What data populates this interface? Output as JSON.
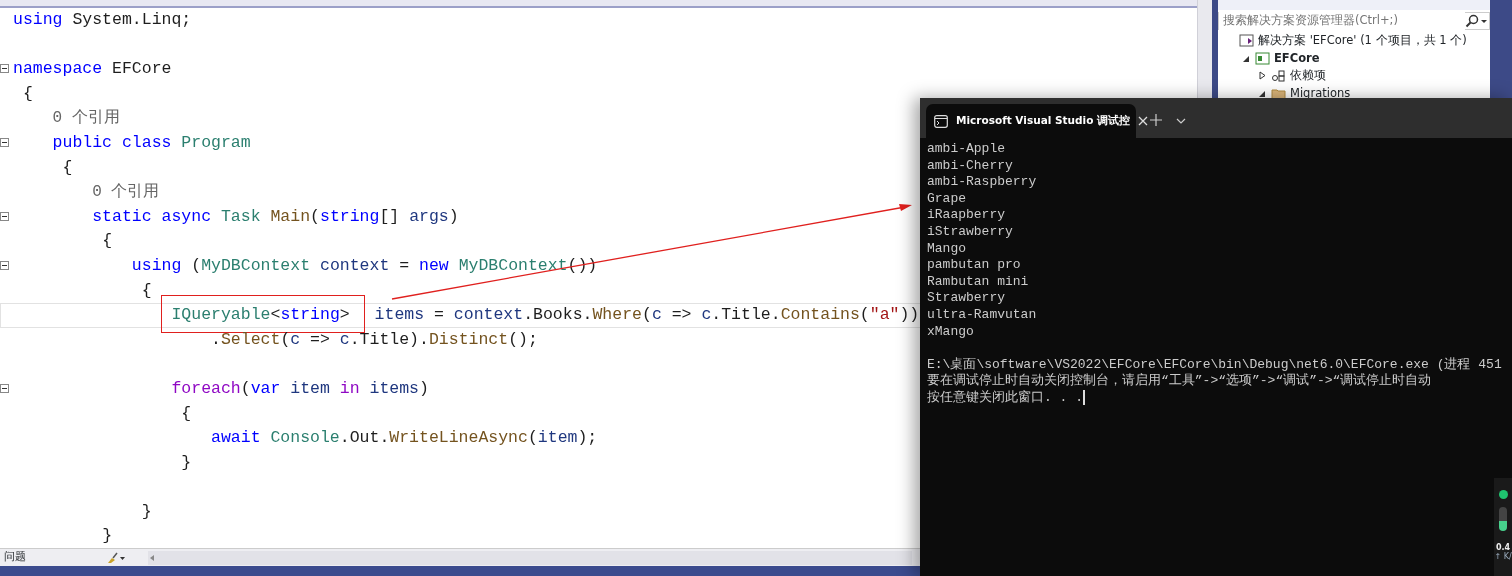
{
  "editor": {
    "lines": [
      {
        "kind": "code",
        "fold": false,
        "tokens": [
          {
            "text": "using",
            "kind": "keyword"
          },
          {
            "text": " System.Linq;",
            "kind": "plain"
          }
        ]
      },
      {
        "kind": "blank"
      },
      {
        "kind": "code",
        "fold": true,
        "tokens": [
          {
            "text": "namespace",
            "kind": "keyword"
          },
          {
            "text": " EFCore",
            "kind": "plain"
          }
        ]
      },
      {
        "kind": "code",
        "fold": false,
        "tokens": [
          {
            "text": " {",
            "kind": "plain"
          }
        ]
      },
      {
        "kind": "lens",
        "text": "    0 个引用"
      },
      {
        "kind": "code",
        "fold": true,
        "tokens": [
          {
            "text": "    public class",
            "kind": "keyword"
          },
          {
            "text": " Program",
            "kind": "type"
          }
        ]
      },
      {
        "kind": "code",
        "fold": false,
        "tokens": [
          {
            "text": "     {",
            "kind": "plain"
          }
        ]
      },
      {
        "kind": "lens",
        "text": "        0 个引用"
      },
      {
        "kind": "code",
        "fold": true,
        "tokens": [
          {
            "text": "        static async",
            "kind": "keyword"
          },
          {
            "text": " Task",
            "kind": "type"
          },
          {
            "text": " Main",
            "kind": "method"
          },
          {
            "text": "(",
            "kind": "plain"
          },
          {
            "text": "string",
            "kind": "keyword"
          },
          {
            "text": "[] ",
            "kind": "plain"
          },
          {
            "text": "args",
            "kind": "param"
          },
          {
            "text": ")",
            "kind": "plain"
          }
        ]
      },
      {
        "kind": "code",
        "fold": false,
        "tokens": [
          {
            "text": "         {",
            "kind": "plain"
          }
        ]
      },
      {
        "kind": "code",
        "fold": true,
        "tokens": [
          {
            "text": "            using",
            "kind": "keyword"
          },
          {
            "text": " (",
            "kind": "plain"
          },
          {
            "text": "MyDBContext",
            "kind": "type"
          },
          {
            "text": " context",
            "kind": "param"
          },
          {
            "text": " = ",
            "kind": "plain"
          },
          {
            "text": "new",
            "kind": "keyword"
          },
          {
            "text": " MyDBContext",
            "kind": "type"
          },
          {
            "text": "())",
            "kind": "plain"
          }
        ]
      },
      {
        "kind": "code",
        "fold": false,
        "tokens": [
          {
            "text": "             {",
            "kind": "plain"
          }
        ]
      },
      {
        "kind": "code",
        "fold": false,
        "current": true,
        "tokens": [
          {
            "text": "                IQueryable",
            "kind": "type",
            "boxed": true
          },
          {
            "text": "<",
            "kind": "plain",
            "boxed": true
          },
          {
            "text": "string",
            "kind": "keyword",
            "boxed": true
          },
          {
            "text": ">",
            "kind": "plain",
            "boxed": true
          },
          {
            "text": " items",
            "kind": "param"
          },
          {
            "text": " = ",
            "kind": "plain"
          },
          {
            "text": "context",
            "kind": "param"
          },
          {
            "text": ".Books.",
            "kind": "plain"
          },
          {
            "text": "Where",
            "kind": "method"
          },
          {
            "text": "(",
            "kind": "plain"
          },
          {
            "text": "c",
            "kind": "param"
          },
          {
            "text": " => ",
            "kind": "plain"
          },
          {
            "text": "c",
            "kind": "param"
          },
          {
            "text": ".Title.",
            "kind": "plain"
          },
          {
            "text": "Contains",
            "kind": "method"
          },
          {
            "text": "(",
            "kind": "plain"
          },
          {
            "text": "\"a\"",
            "kind": "string"
          },
          {
            "text": "))",
            "kind": "plain"
          }
        ]
      },
      {
        "kind": "code",
        "fold": false,
        "tokens": [
          {
            "text": "                    .",
            "kind": "plain"
          },
          {
            "text": "Select",
            "kind": "method"
          },
          {
            "text": "(",
            "kind": "plain"
          },
          {
            "text": "c",
            "kind": "param"
          },
          {
            "text": " => ",
            "kind": "plain"
          },
          {
            "text": "c",
            "kind": "param"
          },
          {
            "text": ".Title).",
            "kind": "plain"
          },
          {
            "text": "Distinct",
            "kind": "method"
          },
          {
            "text": "();",
            "kind": "plain"
          }
        ]
      },
      {
        "kind": "blank"
      },
      {
        "kind": "code",
        "fold": true,
        "tokens": [
          {
            "text": "                foreach",
            "kind": "control"
          },
          {
            "text": "(",
            "kind": "plain"
          },
          {
            "text": "var",
            "kind": "keyword"
          },
          {
            "text": " item",
            "kind": "param"
          },
          {
            "text": " in",
            "kind": "control"
          },
          {
            "text": " items",
            "kind": "param"
          },
          {
            "text": ")",
            "kind": "plain"
          }
        ]
      },
      {
        "kind": "code",
        "fold": false,
        "tokens": [
          {
            "text": "                 {",
            "kind": "plain"
          }
        ]
      },
      {
        "kind": "code",
        "fold": false,
        "tokens": [
          {
            "text": "                    await",
            "kind": "keyword"
          },
          {
            "text": " Console",
            "kind": "type"
          },
          {
            "text": ".Out.",
            "kind": "plain"
          },
          {
            "text": "WriteLineAsync",
            "kind": "method"
          },
          {
            "text": "(",
            "kind": "plain"
          },
          {
            "text": "item",
            "kind": "param"
          },
          {
            "text": ");",
            "kind": "plain"
          }
        ]
      },
      {
        "kind": "code",
        "fold": false,
        "tokens": [
          {
            "text": "                 }",
            "kind": "plain"
          }
        ]
      },
      {
        "kind": "blank"
      },
      {
        "kind": "code",
        "fold": false,
        "tokens": [
          {
            "text": "             }",
            "kind": "plain"
          }
        ]
      },
      {
        "kind": "code",
        "fold": false,
        "tokens": [
          {
            "text": "         }",
            "kind": "plain"
          }
        ]
      }
    ]
  },
  "status_bar": {
    "label": "问题"
  },
  "solution_explorer": {
    "search": {
      "placeholder": "搜索解决方案资源管理器(Ctrl+;)"
    },
    "tree": [
      {
        "label": "解决方案 'EFCore' (1 个项目，共 1 个)",
        "kind": "solution",
        "bold": false,
        "children": [
          {
            "label": "EFCore",
            "kind": "project",
            "bold": true,
            "expanded": true,
            "children": [
              {
                "label": "依赖项",
                "kind": "dependencies",
                "bold": false,
                "expanded": false
              },
              {
                "label": "Migrations",
                "kind": "folder",
                "bold": false,
                "expanded": true
              }
            ]
          }
        ]
      }
    ]
  },
  "terminal": {
    "tab_title": "Microsoft Visual Studio 调试控",
    "output": [
      "ambi-Apple",
      "ambi-Cherry",
      "ambi-Raspberry",
      "Grape",
      "iRaapberry",
      "iStrawberry",
      "Mango",
      "pambutan pro",
      "Rambutan mini",
      "Strawberry",
      "ultra-Ramvutan",
      "xMango"
    ],
    "messages": [
      "E:\\桌面\\software\\VS2022\\EFCore\\EFCore\\bin\\Debug\\net6.0\\EFCore.exe (进程 451",
      "要在调试停止时自动关闭控制台，请启用“工具”->“选项”->“调试”->“调试停止时自动",
      "按任意键关闭此窗口. . ."
    ]
  },
  "widget": {
    "value": "0.4",
    "unit": "↑ K/"
  }
}
